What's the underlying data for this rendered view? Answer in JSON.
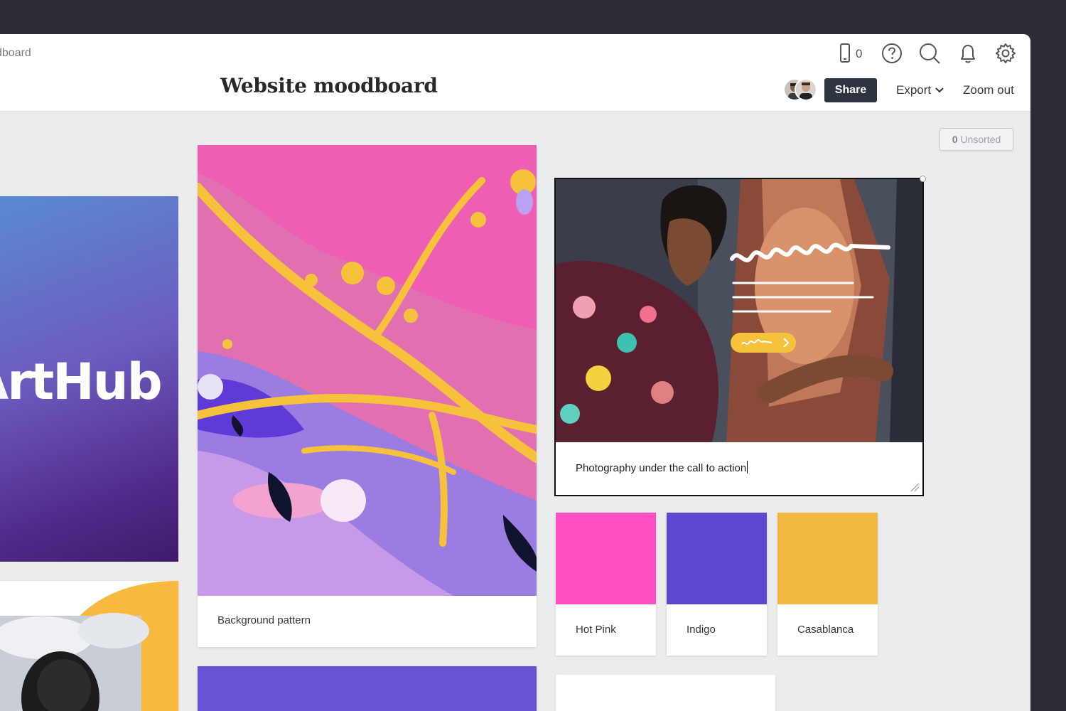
{
  "header": {
    "breadcrumb": "dboard",
    "title": "Website moodboard",
    "phone_count": "0",
    "share_label": "Share",
    "export_label": "Export",
    "zoom_label": "Zoom out",
    "icons": [
      "phone-icon",
      "help-icon",
      "search-icon",
      "bell-icon",
      "gear-icon"
    ]
  },
  "board": {
    "unsorted_count": "0",
    "unsorted_label": "Unsorted",
    "logo_text": "rtHub",
    "cards": {
      "background_caption": "Background pattern",
      "cta_caption": "Photography under the call to action"
    },
    "swatches": [
      {
        "name": "Hot Pink",
        "color": "#ff4fc2"
      },
      {
        "name": "Indigo",
        "color": "#5b48cf"
      },
      {
        "name": "Casablanca",
        "color": "#f1b93f"
      }
    ]
  },
  "colors": {
    "chrome": "#2d2c35",
    "share_button": "#2e3440",
    "canvas": "#ebecee"
  }
}
